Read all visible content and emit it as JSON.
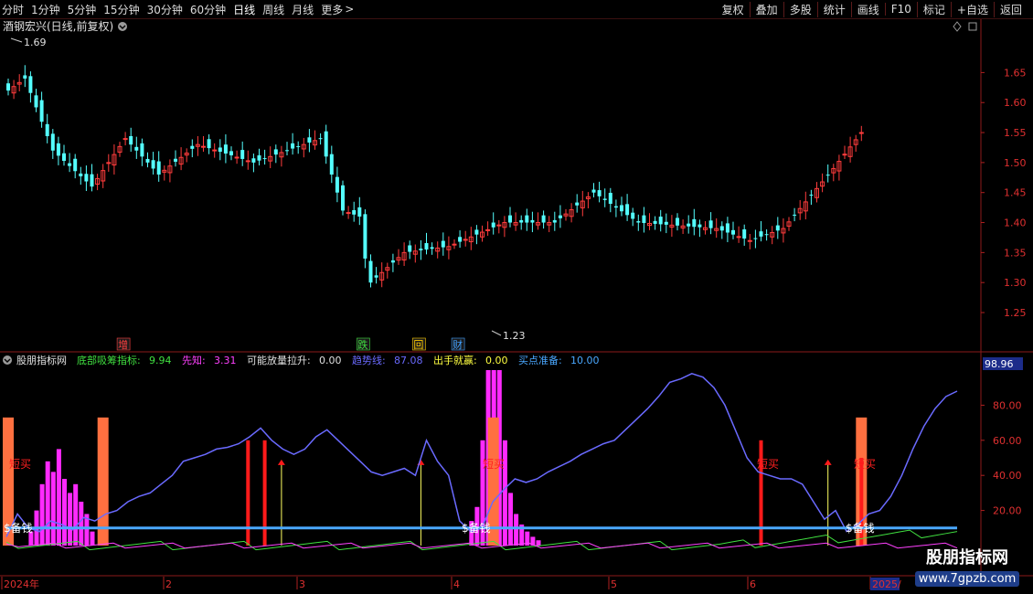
{
  "toolbar": {
    "periods": [
      "分时",
      "1分钟",
      "5分钟",
      "15分钟",
      "30分钟",
      "60分钟",
      "日线",
      "周线",
      "月线",
      "更多"
    ],
    "active_period": "日线",
    "more_arrow": ">",
    "actions": [
      "复权",
      "叠加",
      "多股",
      "统计",
      "画线",
      "F10",
      "标记",
      "+自选",
      "返回"
    ]
  },
  "main_chart": {
    "title": "酒钢宏兴(日线,前复权)",
    "high_label": "1.69",
    "low_label": "1.23",
    "price_axis": [
      "1.65",
      "1.60",
      "1.55",
      "1.50",
      "1.45",
      "1.40",
      "1.35",
      "1.30",
      "1.25"
    ],
    "ylim": [
      1.215,
      1.71
    ],
    "event_marks": [
      {
        "text": "增",
        "color": "#ff4040",
        "idx": 21
      },
      {
        "text": "跌",
        "color": "#40e040",
        "idx": 64
      },
      {
        "text": "回",
        "color": "#ffcc00",
        "idx": 74
      },
      {
        "text": "财",
        "color": "#40a0ff",
        "idx": 81
      }
    ],
    "colors": {
      "up": "#ff3c3c",
      "down": "#54ffff"
    }
  },
  "indicator": {
    "name": "股朋指标网",
    "items": [
      {
        "label": "底部吸筹指标:",
        "value": "9.94",
        "color": "#40e040"
      },
      {
        "label": "先知:",
        "value": "3.31",
        "color": "#ff40ff"
      },
      {
        "label": "可能放量拉升:",
        "value": "0.00",
        "color": "#e0e0e0"
      },
      {
        "label": "趋势线:",
        "value": "87.08",
        "color": "#6a6aff"
      },
      {
        "label": "出手就赢:",
        "value": "0.00",
        "color": "#ffff40"
      },
      {
        "label": "买点准备:",
        "value": "10.00",
        "color": "#4aa8ff"
      }
    ],
    "axis_labels": [
      "80.00",
      "60.00",
      "40.00",
      "20.00"
    ],
    "current_value": "98.96",
    "buy_label": "短买",
    "money_label": "$备钱"
  },
  "date_axis": [
    "2024年",
    "2",
    "3",
    "4",
    "5",
    "6",
    "2025/"
  ],
  "watermark": {
    "title": "股朋指标网",
    "url": "www.7gpzb.com"
  }
}
